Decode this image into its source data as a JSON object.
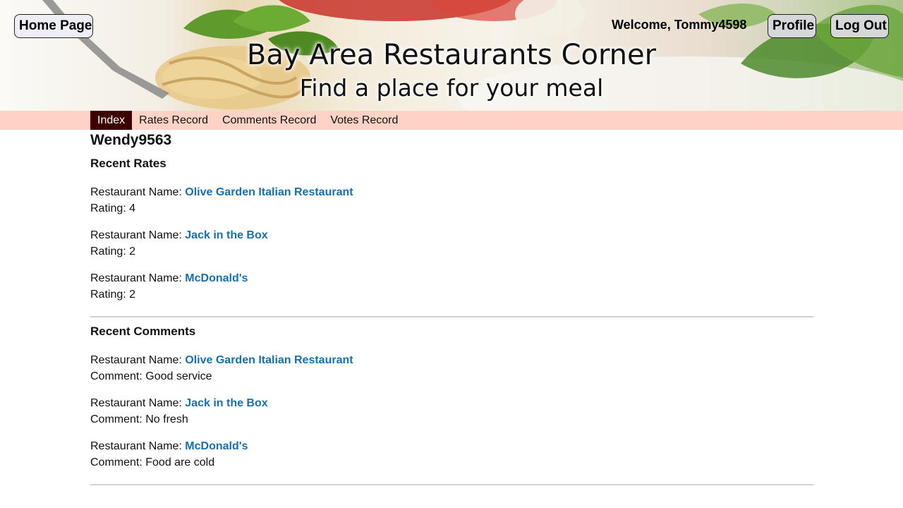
{
  "header": {
    "home_label": "Home Page",
    "welcome_text": "Welcome, Tommy4598",
    "profile_label": "Profile",
    "logout_label": "Log Out",
    "site_title": "Bay Area Restaurants Corner",
    "site_subtitle": "Find a place for your meal"
  },
  "nav": {
    "tabs": [
      {
        "label": "Index",
        "active": true
      },
      {
        "label": "Rates Record",
        "active": false
      },
      {
        "label": "Comments Record",
        "active": false
      },
      {
        "label": "Votes Record",
        "active": false
      }
    ]
  },
  "profile": {
    "username": "Wendy9563"
  },
  "recent_rates": {
    "title": "Recent Rates",
    "name_prefix": "Restaurant Name: ",
    "rating_prefix": "Rating: ",
    "items": [
      {
        "restaurant": "Olive Garden Italian Restaurant",
        "rating": "4"
      },
      {
        "restaurant": "Jack in the Box",
        "rating": "2"
      },
      {
        "restaurant": "McDonald's",
        "rating": "2"
      }
    ]
  },
  "recent_comments": {
    "title": "Recent Comments",
    "name_prefix": "Restaurant Name: ",
    "comment_prefix": "Comment: ",
    "items": [
      {
        "restaurant": "Olive Garden Italian Restaurant",
        "comment": "Good service"
      },
      {
        "restaurant": "Jack in the Box",
        "comment": "No fresh"
      },
      {
        "restaurant": "McDonald's",
        "comment": "Food are cold"
      }
    ]
  },
  "colors": {
    "nav_background": "#fcd3c4",
    "nav_active": "#3d0000",
    "link": "#1670ad"
  }
}
